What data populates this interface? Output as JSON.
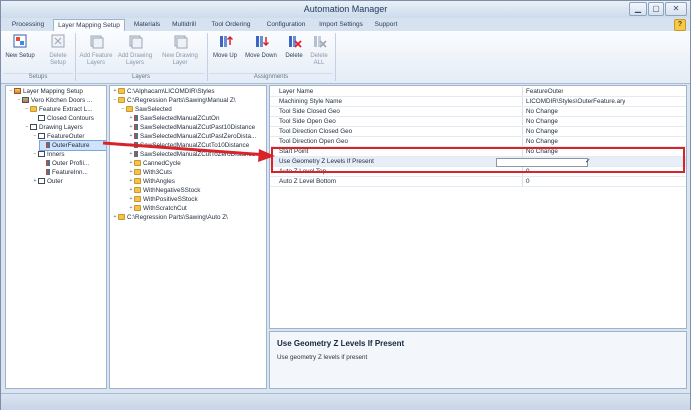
{
  "window": {
    "title": "Automation Manager"
  },
  "tabs": [
    "Processing",
    "Layer Mapping Setup",
    "Materials",
    "Multidrill",
    "Tool Ordering",
    "Configuration",
    "Import Settings",
    "Support"
  ],
  "ribbon": {
    "buttons": [
      {
        "label1": "New Setup",
        "label2": ""
      },
      {
        "label1": "Delete",
        "label2": "Setup"
      },
      {
        "label1": "Add Feature",
        "label2": "Layers"
      },
      {
        "label1": "Add Drawing",
        "label2": "Layers"
      },
      {
        "label1": "New Drawing",
        "label2": "Layer"
      },
      {
        "label1": "Move Up",
        "label2": ""
      },
      {
        "label1": "Move Down",
        "label2": ""
      },
      {
        "label1": "Delete",
        "label2": ""
      },
      {
        "label1": "Delete",
        "label2": "ALL"
      }
    ],
    "groups": [
      "Setups",
      "Layers",
      "Assignments"
    ]
  },
  "tree": [
    {
      "label": "Layer Mapping Setup",
      "exp": "−"
    },
    {
      "label": "Vero Kitchen Doors ...",
      "exp": "−"
    },
    {
      "label": "Feature Extract L...",
      "exp": "−"
    },
    {
      "label": "Closed Contours",
      "exp": ""
    },
    {
      "label": "Drawing Layers",
      "exp": "−"
    },
    {
      "label": "FeatureOuter",
      "exp": "−"
    },
    {
      "label": "OuterFeature",
      "exp": ""
    },
    {
      "label": "Inners",
      "exp": "−"
    },
    {
      "label": "Outer Profil...",
      "exp": ""
    },
    {
      "label": "FeatureInn...",
      "exp": ""
    },
    {
      "label": "Outer",
      "exp": "+"
    }
  ],
  "styles": [
    {
      "label": "C:\\Alphacam\\LICOMDIR\\Styles",
      "exp": "+"
    },
    {
      "label": "C:\\Regression Parts\\Sawing\\Manual Z\\",
      "exp": "−"
    },
    {
      "label": "SawSelected",
      "exp": "−"
    },
    {
      "label": "SawSelectedManualZCutOn",
      "exp": "+"
    },
    {
      "label": "SawSelectedManualZCutPast10Distance",
      "exp": "+"
    },
    {
      "label": "SawSelectedManualZCutPastZeroDista...",
      "exp": "+"
    },
    {
      "label": "SawSelectedManualZCutTo10Distance",
      "exp": "+"
    },
    {
      "label": "SawSelectedManualZCutToZeroDistance",
      "exp": "+"
    },
    {
      "label": "CannedCycle",
      "exp": "+"
    },
    {
      "label": "With3Cuts",
      "exp": "+"
    },
    {
      "label": "WithAngles",
      "exp": "+"
    },
    {
      "label": "WithNegativeSStock",
      "exp": "+"
    },
    {
      "label": "WithPositiveSStock",
      "exp": "+"
    },
    {
      "label": "WithScratchCut",
      "exp": "+"
    },
    {
      "label": "C:\\Regression Parts\\Sawing\\Auto Z\\",
      "exp": "+"
    }
  ],
  "properties": [
    {
      "name": "Layer Name",
      "value": "FeatureOuter"
    },
    {
      "name": "Machining Style Name",
      "value": "LICOMDIR\\Styles\\OuterFeature.ary"
    },
    {
      "name": "Tool Side Closed Geo",
      "value": "No Change"
    },
    {
      "name": "Tool Side Open Geo",
      "value": "No Change"
    },
    {
      "name": "Tool Direction Closed Geo",
      "value": "No Change"
    },
    {
      "name": "Tool Direction Open Geo",
      "value": "No Change"
    },
    {
      "name": "Start Point",
      "value": "No Change"
    },
    {
      "name": "Use Geometry Z Levels If Present",
      "value": "✓"
    },
    {
      "name": "Auto Z Level Top",
      "value": "0"
    },
    {
      "name": "Auto Z Level Bottom",
      "value": "0"
    }
  ],
  "description": {
    "title": "Use Geometry Z Levels If Present",
    "text": "Use geometry Z levels if present"
  },
  "colors": {
    "highlight": "#d9232a",
    "selection": "#cfe2fb",
    "folder": "#f2c44a"
  }
}
